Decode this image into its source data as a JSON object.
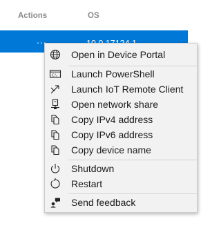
{
  "table": {
    "headers": {
      "actions": "Actions",
      "os": "OS"
    },
    "selected_row": {
      "actions": "...",
      "os": "10.0.17134.1"
    }
  },
  "context_menu": {
    "items": [
      {
        "label": "Open in Device Portal",
        "icon": "globe-icon"
      },
      {
        "label": "Launch PowerShell",
        "icon": "powershell-icon"
      },
      {
        "label": "Launch IoT Remote Client",
        "icon": "remote-client-icon"
      },
      {
        "label": "Open network share",
        "icon": "network-share-icon"
      },
      {
        "label": "Copy IPv4 address",
        "icon": "copy-icon"
      },
      {
        "label": "Copy IPv6 address",
        "icon": "copy-icon"
      },
      {
        "label": "Copy device name",
        "icon": "copy-icon"
      },
      {
        "label": "Shutdown",
        "icon": "power-icon"
      },
      {
        "label": "Restart",
        "icon": "restart-icon"
      },
      {
        "label": "Send feedback",
        "icon": "feedback-icon"
      }
    ]
  },
  "colors": {
    "selection": "#0078d7",
    "menu_background": "#f2f2f2",
    "header_text": "#8a8a8a"
  }
}
